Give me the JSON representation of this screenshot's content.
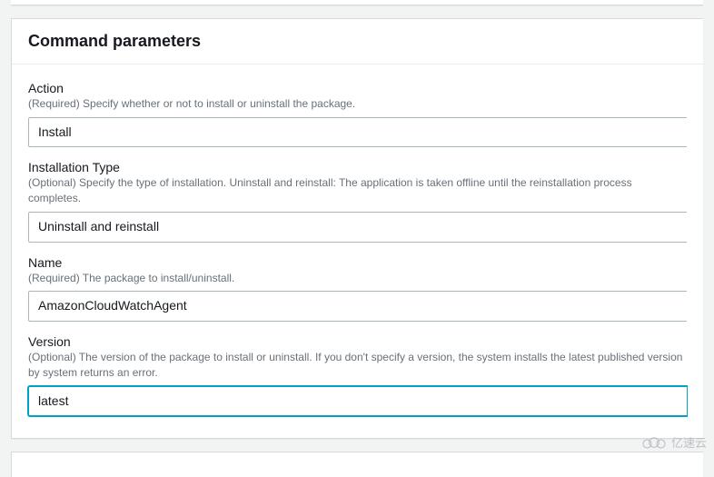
{
  "section": {
    "title": "Command parameters"
  },
  "fields": {
    "action": {
      "label": "Action",
      "description": "(Required) Specify whether or not to install or uninstall the package.",
      "value": "Install"
    },
    "installation_type": {
      "label": "Installation Type",
      "description": "(Optional) Specify the type of installation. Uninstall and reinstall: The application is taken offline until the reinstallation process completes.",
      "value": "Uninstall and reinstall"
    },
    "name": {
      "label": "Name",
      "description": "(Required) The package to install/uninstall.",
      "value": "AmazonCloudWatchAgent"
    },
    "version": {
      "label": "Version",
      "description": "(Optional) The version of the package to install or uninstall. If you don't specify a version, the system installs the latest published version by system returns an error.",
      "value": "latest"
    }
  },
  "watermark": {
    "text": "亿速云"
  }
}
